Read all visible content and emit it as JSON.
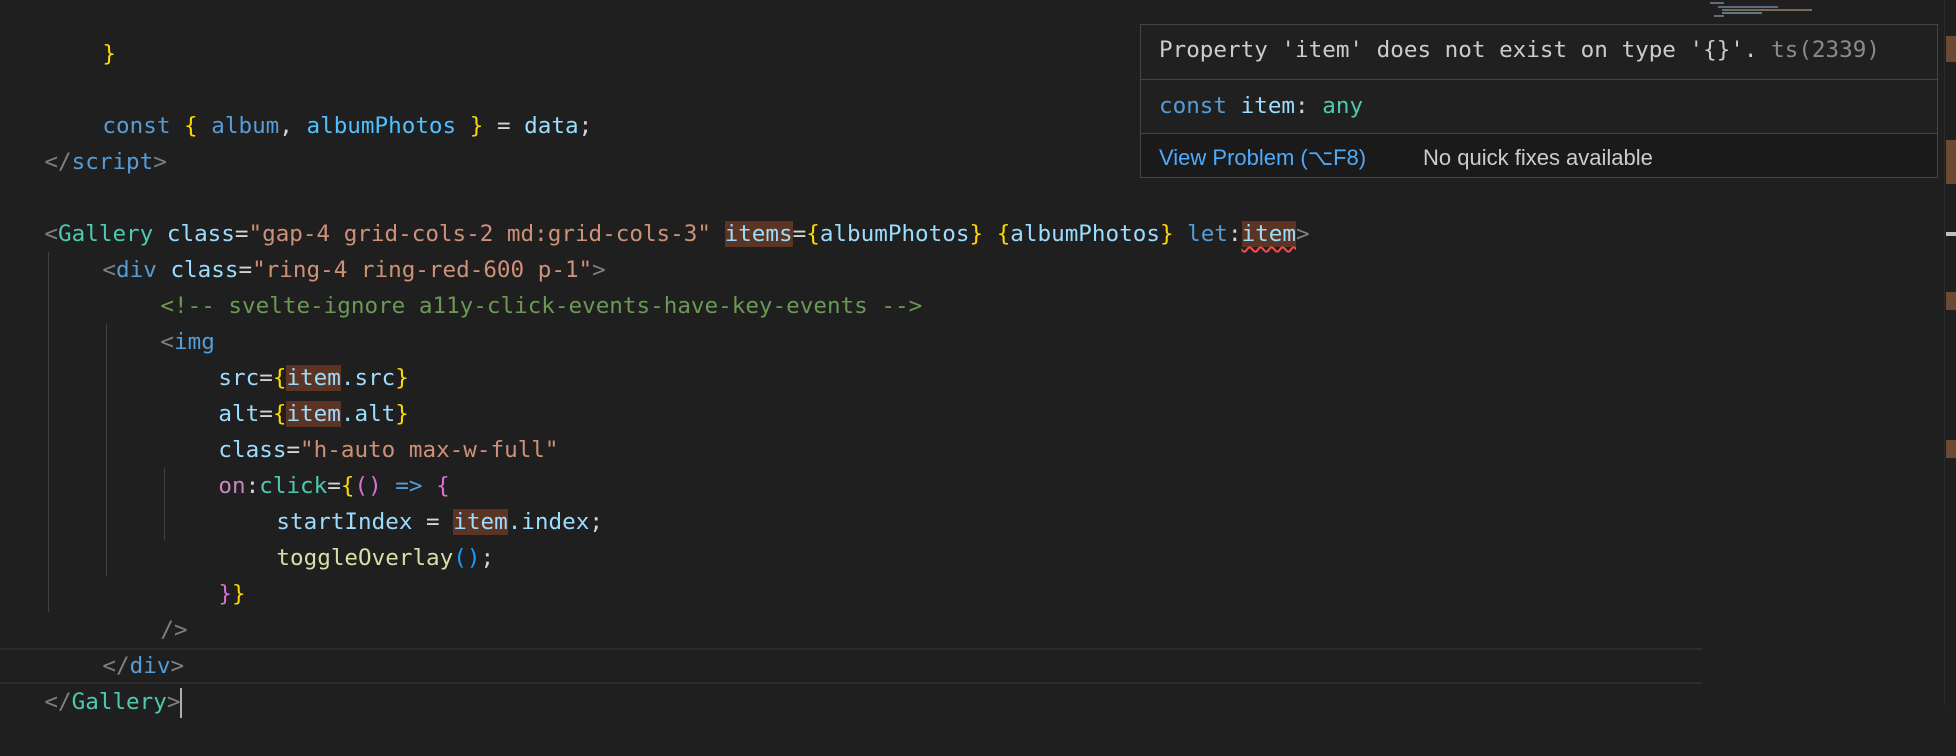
{
  "editor": {
    "lines": {
      "l0": {
        "t1": "}"
      },
      "l1": {
        "t1": "const",
        "t2": " ",
        "t3": "{",
        "t4": " album",
        "t5": ", ",
        "t6": "albumPhotos",
        "t7": " ",
        "t8": "}",
        "t9": " = ",
        "t10": "data",
        "t11": ";"
      },
      "l2": {
        "t1": "</",
        "t2": "script",
        "t3": ">"
      },
      "l3": {
        "t1": "<",
        "t2": "Gallery",
        "t3": " ",
        "t4": "class",
        "t5": "=",
        "t6": "\"gap-4 grid-cols-2 md:grid-cols-3\"",
        "t7": " ",
        "t8": "items",
        "t9": "=",
        "t10": "{",
        "t11": "albumPhotos",
        "t12": "}",
        "t13": " ",
        "t14": "{",
        "t15": "albumPhotos",
        "t16": "}",
        "t17": " ",
        "t18": "let",
        "t19": ":",
        "t20": "item",
        "t21": ">"
      },
      "l4": {
        "t1": "<",
        "t2": "div",
        "t3": " ",
        "t4": "class",
        "t5": "=",
        "t6": "\"ring-4 ring-red-600 p-1\"",
        "t7": ">"
      },
      "l5": {
        "t1": "<!-- svelte-ignore a11y-click-events-have-key-events -->"
      },
      "l6": {
        "t1": "<",
        "t2": "img"
      },
      "l7": {
        "t1": "src",
        "t2": "=",
        "t3": "{",
        "t4": "item",
        "t5": ".src",
        "t6": "}"
      },
      "l8": {
        "t1": "alt",
        "t2": "=",
        "t3": "{",
        "t4": "item",
        "t5": ".alt",
        "t6": "}"
      },
      "l9": {
        "t1": "class",
        "t2": "=",
        "t3": "\"h-auto max-w-full\""
      },
      "l10": {
        "t1": "on",
        "t2": ":",
        "t3": "click",
        "t4": "=",
        "t5": "{",
        "t6": "()",
        "t7": " => ",
        "t8": "{"
      },
      "l11": {
        "t1": "startIndex",
        "t2": " = ",
        "t3": "item",
        "t4": ".index",
        "t5": ";"
      },
      "l12": {
        "t1": "toggleOverlay",
        "t2": "()",
        "t3": ";"
      },
      "l13": {
        "t1": "}}"
      },
      "l14": {
        "t1": "/>"
      },
      "l15": {
        "t1": "</",
        "t2": "div",
        "t3": ">"
      },
      "l16": {
        "t1": "</",
        "t2": "Gallery",
        "t3": ">"
      }
    }
  },
  "hover": {
    "message": "Property 'item' does not exist on type '{}'. ",
    "error_code": "ts(2339)",
    "signature_kw": "const",
    "signature_name": " item",
    "signature_colon": ": ",
    "signature_type": "any",
    "view_problem_label": "View Problem (⌥F8)",
    "no_fixes_label": "No quick fixes available"
  },
  "colors": {
    "background": "#1f1f1f",
    "keyword": "#569cd6",
    "variable": "#9cdcfe",
    "string": "#ce9178",
    "comment": "#6a9955",
    "component": "#4ec9b0",
    "function": "#dcdcaa",
    "highlight": "#5b3424",
    "error_squiggle": "#f14c4c",
    "link": "#4daafc"
  }
}
